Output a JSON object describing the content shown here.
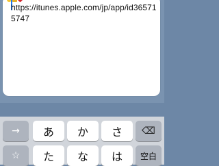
{
  "compose": {
    "emoji": [
      "smiley-emoji",
      "bag-emoji",
      "heart-emoji"
    ],
    "text": "https://itunes.apple.com/jp/app/id365715747"
  },
  "keyboard": {
    "row1": {
      "left_icon": "→",
      "keys": [
        "あ",
        "か",
        "さ"
      ],
      "right_icon": "⌫"
    },
    "row2": {
      "left_icon": "☆",
      "keys": [
        "た",
        "な",
        "は"
      ],
      "right_label": "空白"
    }
  },
  "colors": {
    "accent": "#1e7bf0",
    "background": "#7a93b0",
    "keyboard": "#d1d5db"
  }
}
